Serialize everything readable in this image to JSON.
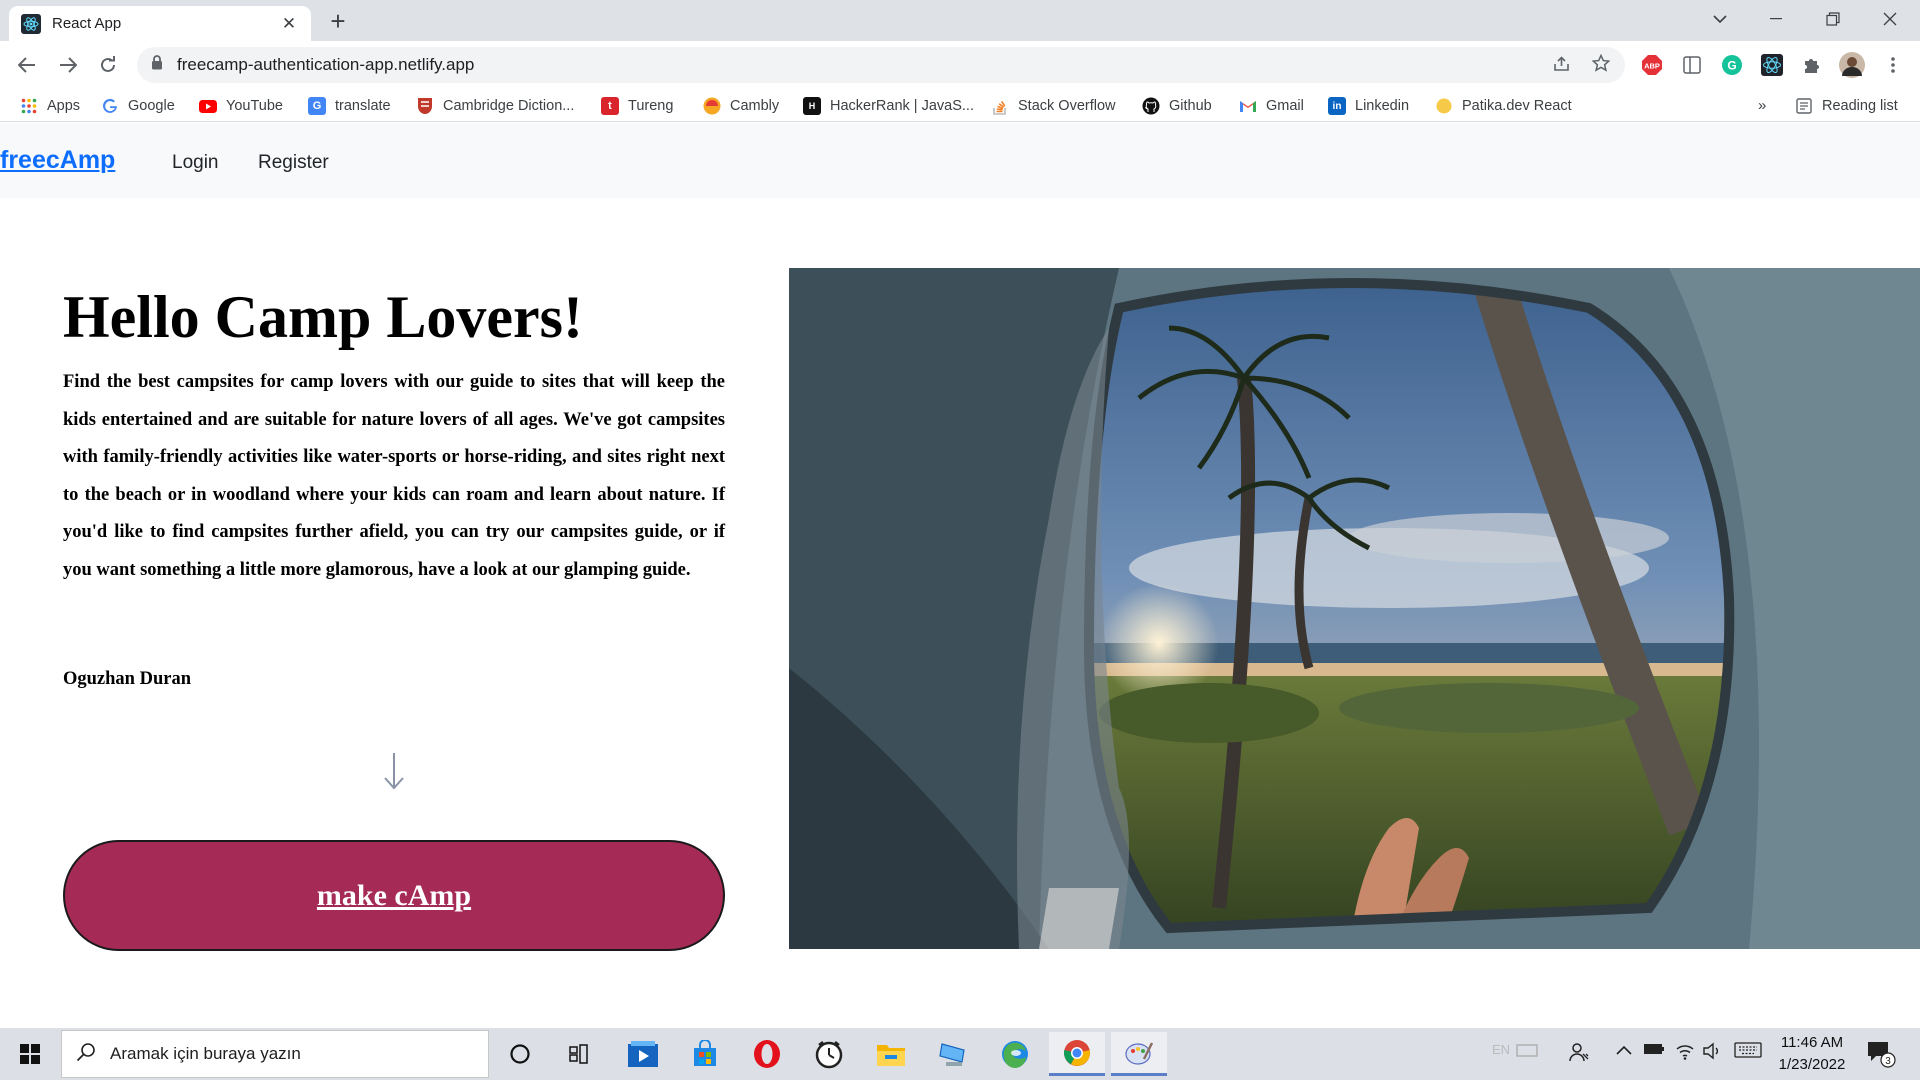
{
  "browser": {
    "tab_title": "React App",
    "tab_favicon": "react-icon",
    "url": "freecamp-authentication-app.netlify.app",
    "bookmarks": [
      {
        "label": "Apps",
        "icon": "apps-grid-icon"
      },
      {
        "label": "Google",
        "icon": "google-icon"
      },
      {
        "label": "YouTube",
        "icon": "youtube-icon"
      },
      {
        "label": "translate",
        "icon": "translate-icon"
      },
      {
        "label": "Cambridge Diction...",
        "icon": "cambridge-icon"
      },
      {
        "label": "Tureng",
        "icon": "tureng-icon"
      },
      {
        "label": "Cambly",
        "icon": "cambly-icon"
      },
      {
        "label": "HackerRank | JavaS...",
        "icon": "hackerrank-icon"
      },
      {
        "label": "Stack Overflow",
        "icon": "stackoverflow-icon"
      },
      {
        "label": "Github",
        "icon": "github-icon"
      },
      {
        "label": "Gmail",
        "icon": "gmail-icon"
      },
      {
        "label": "Linkedin",
        "icon": "linkedin-icon"
      },
      {
        "label": "Patika.dev React",
        "icon": "patika-icon"
      }
    ],
    "overflow_chevron": "»",
    "reading_list": "Reading list",
    "extensions": {
      "abp": "ABP",
      "grammarly": "G"
    }
  },
  "app": {
    "brand": "freecAmp",
    "nav": {
      "login": "Login",
      "register": "Register"
    },
    "hero": {
      "title": "Hello Camp Lovers!",
      "text": "Find the best campsites for camp lovers with our guide to sites that will keep the kids entertained and are suitable for nature lovers of all ages. We've got campsites with family-friendly activities like water-sports or horse-riding, and sites right next to the beach or in woodland where your kids can roam and learn about nature. If you'd like to find campsites further afield, you can try our campsites guide, or if you want something a little more glamorous, have a look at our glamping guide.",
      "author": "Oguzhan Duran",
      "cta": "make cAmp"
    },
    "colors": {
      "brand": "#0d6efd",
      "cta": "#a52a56"
    }
  },
  "taskbar": {
    "search_placeholder": "Aramak için buraya yazın",
    "language": "EN",
    "time": "11:46 AM",
    "date": "1/23/2022",
    "notification_count": "3"
  }
}
